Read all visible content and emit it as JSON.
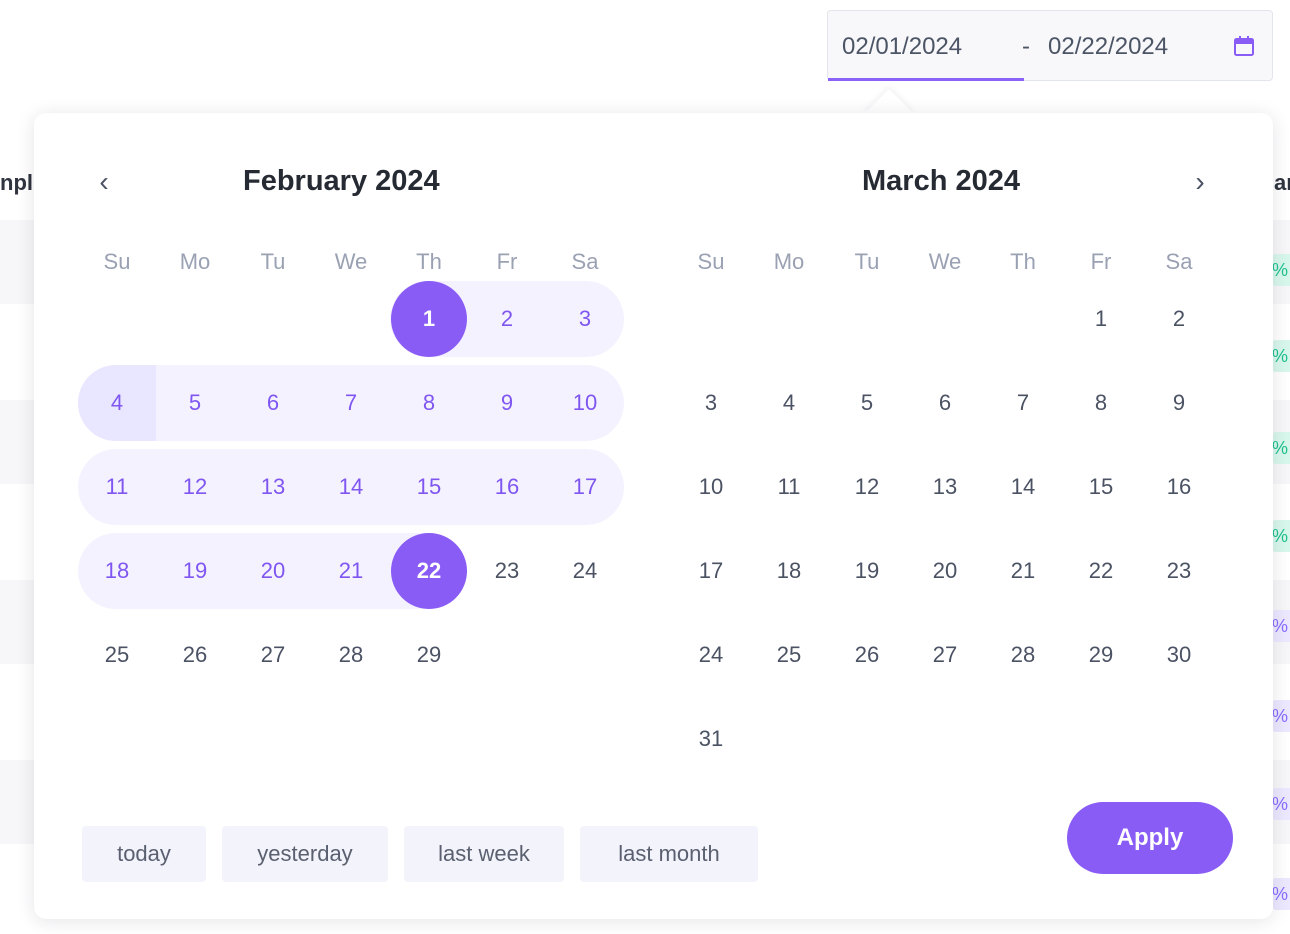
{
  "date_input": {
    "start": "02/01/2024",
    "separator": "-",
    "end": "02/22/2024",
    "icon": "calendar-icon"
  },
  "background": {
    "left_header": "npl",
    "right_header": "ar",
    "badges": [
      "%",
      "%",
      "%",
      "%",
      "%",
      "%",
      "%",
      "%"
    ]
  },
  "calendar": {
    "prev_label": "‹",
    "next_label": "›",
    "weekdays": [
      "Su",
      "Mo",
      "Tu",
      "We",
      "Th",
      "Fr",
      "Sa"
    ],
    "left_month": {
      "title": "February 2024",
      "days": [
        "1",
        "2",
        "3",
        "4",
        "5",
        "6",
        "7",
        "8",
        "9",
        "10",
        "11",
        "12",
        "13",
        "14",
        "15",
        "16",
        "17",
        "18",
        "19",
        "20",
        "21",
        "22",
        "23",
        "24",
        "25",
        "26",
        "27",
        "28",
        "29"
      ]
    },
    "right_month": {
      "title": "March 2024",
      "days": [
        "1",
        "2",
        "3",
        "4",
        "5",
        "6",
        "7",
        "8",
        "9",
        "10",
        "11",
        "12",
        "13",
        "14",
        "15",
        "16",
        "17",
        "18",
        "19",
        "20",
        "21",
        "22",
        "23",
        "24",
        "25",
        "26",
        "27",
        "28",
        "29",
        "30",
        "31"
      ]
    }
  },
  "presets": [
    "today",
    "yesterday",
    "last week",
    "last month"
  ],
  "apply_label": "Apply",
  "colors": {
    "accent": "#8a5cf6",
    "range_bg": "#f4f2ff",
    "range_text": "#7f56f0"
  }
}
